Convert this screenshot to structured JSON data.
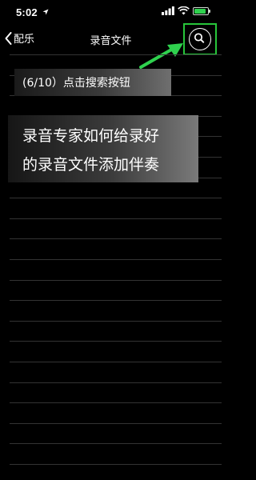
{
  "status_bar": {
    "time": "5:02",
    "location_icon": "location-arrow-icon",
    "signal_icon": "signal-bars-icon",
    "wifi_icon": "wifi-icon",
    "battery_level": 0.85,
    "battery_color": "#2fd14e"
  },
  "nav": {
    "back_label": "配乐",
    "title": "录音文件",
    "back_icon": "chevron-left-icon",
    "search_icon": "search-icon"
  },
  "annotation": {
    "highlight_color": "#27c53a",
    "arrow_icon": "arrow-icon"
  },
  "overlay": {
    "step_caption": "(6/10）点击搜索按钮",
    "headline_line1": "录音专家如何给录好",
    "headline_line2": "的录音文件添加伴奏"
  }
}
